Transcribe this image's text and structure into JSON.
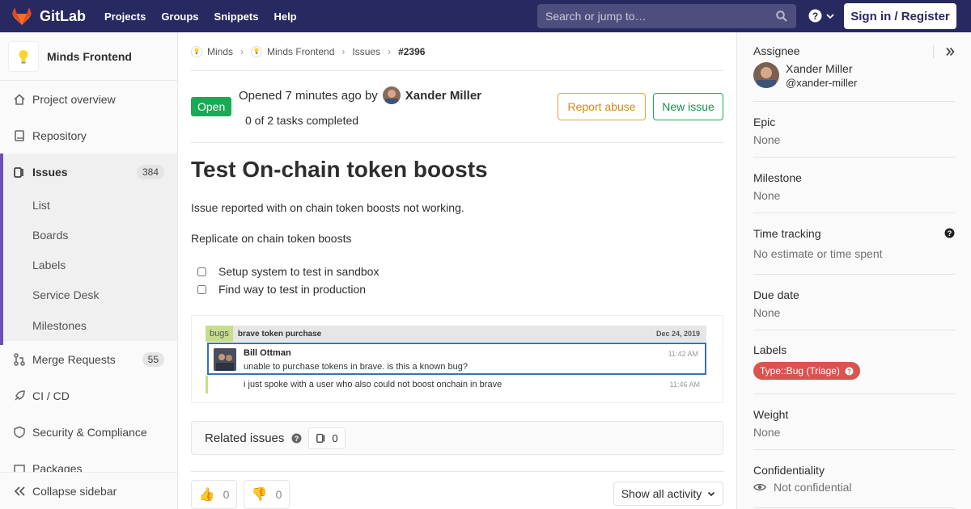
{
  "topnav": {
    "brand": "GitLab",
    "links": [
      "Projects",
      "Groups",
      "Snippets",
      "Help"
    ],
    "search_placeholder": "Search or jump to…",
    "signin": "Sign in / Register"
  },
  "sidebar": {
    "project_name": "Minds Frontend",
    "items": {
      "overview": "Project overview",
      "repository": "Repository",
      "issues": "Issues",
      "issues_count": "384",
      "list": "List",
      "boards": "Boards",
      "labels": "Labels",
      "service_desk": "Service Desk",
      "milestones": "Milestones",
      "merge_requests": "Merge Requests",
      "mr_count": "55",
      "cicd": "CI / CD",
      "security": "Security & Compliance",
      "packages": "Packages"
    },
    "collapse": "Collapse sidebar"
  },
  "breadcrumb": {
    "group": "Minds",
    "project": "Minds Frontend",
    "section": "Issues",
    "current": "#2396"
  },
  "issue": {
    "status": "Open",
    "opened_text": "Opened 7 minutes ago by",
    "author": "Xander Miller",
    "tasks": "0 of 2 tasks completed",
    "report_abuse": "Report abuse",
    "new_issue": "New issue",
    "title": "Test On-chain token boosts",
    "desc1": "Issue reported with on chain token boosts not working.",
    "desc2": "Replicate on chain token boosts",
    "task1": "Setup system to test in sandbox",
    "task2": "Find way to test in production"
  },
  "screenshot": {
    "tag": "bugs",
    "channel": "brave token purchase",
    "date": "Dec 24, 2019",
    "msg_author": "Bill Ottman",
    "msg_text": "unable to purchase tokens in brave. is this a known bug?",
    "msg_time": "11:42 AM",
    "msg2_text": "i just spoke with a user who also could not boost onchain in brave",
    "msg2_time": "11:46 AM"
  },
  "related": {
    "title": "Related issues",
    "count": "0"
  },
  "awards": {
    "thumbsup": "0",
    "thumbsdown": "0"
  },
  "activity_filter": "Show all activity",
  "right": {
    "assignee_title": "Assignee",
    "assignee_name": "Xander Miller",
    "assignee_handle": "@xander-miller",
    "epic_title": "Epic",
    "epic_value": "None",
    "milestone_title": "Milestone",
    "milestone_value": "None",
    "time_title": "Time tracking",
    "time_value": "No estimate or time spent",
    "due_title": "Due date",
    "due_value": "None",
    "labels_title": "Labels",
    "label": "Type::Bug (Triage)",
    "weight_title": "Weight",
    "weight_value": "None",
    "conf_title": "Confidentiality",
    "conf_value": "Not confidential"
  }
}
